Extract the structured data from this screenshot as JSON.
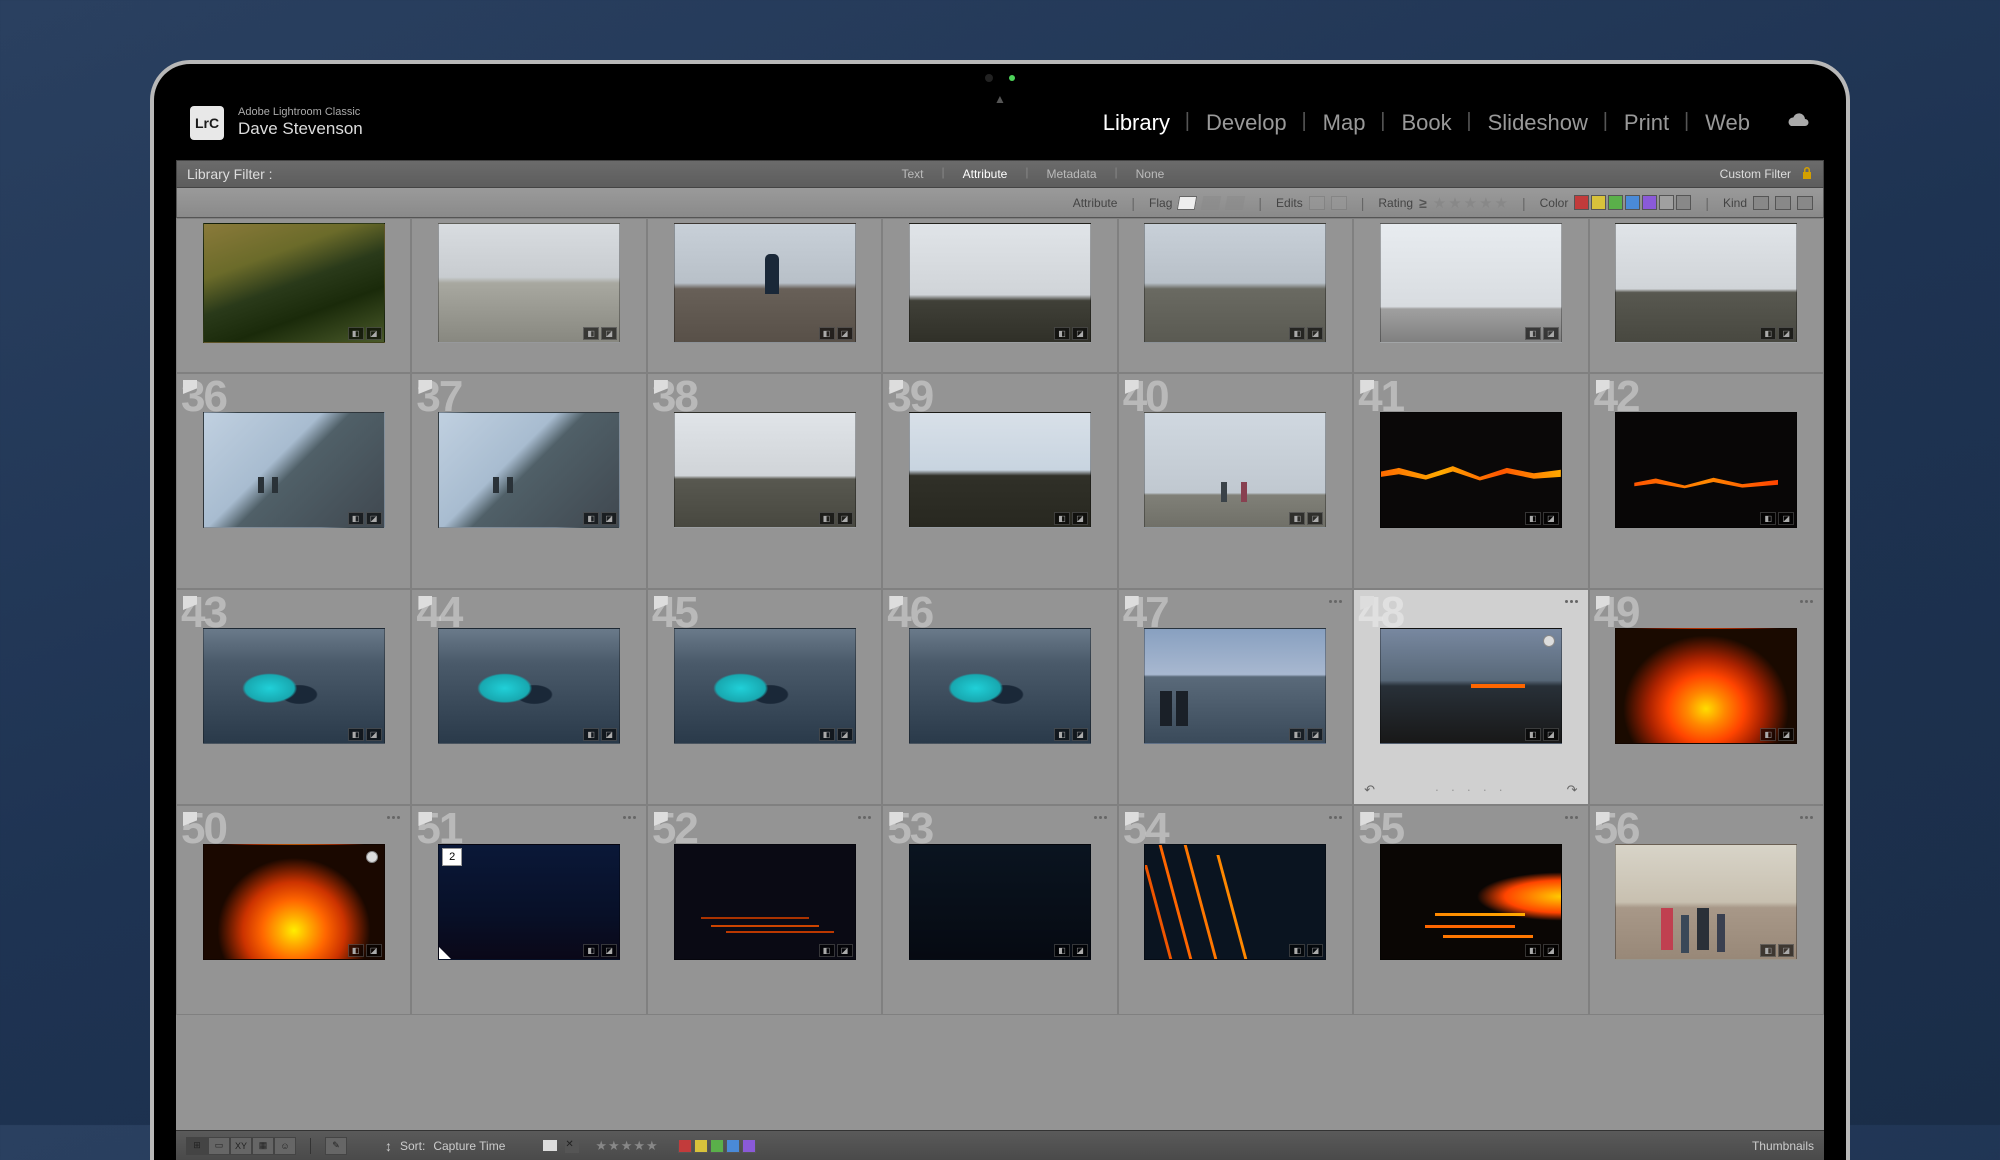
{
  "brand": {
    "logo": "LrC",
    "product": "Adobe Lightroom Classic",
    "user": "Dave Stevenson"
  },
  "modules": [
    {
      "label": "Library",
      "active": true
    },
    {
      "label": "Develop",
      "active": false
    },
    {
      "label": "Map",
      "active": false
    },
    {
      "label": "Book",
      "active": false
    },
    {
      "label": "Slideshow",
      "active": false
    },
    {
      "label": "Print",
      "active": false
    },
    {
      "label": "Web",
      "active": false
    }
  ],
  "filter_bar": {
    "title": "Library Filter :",
    "tabs": [
      {
        "label": "Text",
        "active": false
      },
      {
        "label": "Attribute",
        "active": true
      },
      {
        "label": "Metadata",
        "active": false
      },
      {
        "label": "None",
        "active": false
      }
    ],
    "custom": "Custom Filter"
  },
  "attribute_bar": {
    "attribute": "Attribute",
    "flag": "Flag",
    "edits": "Edits",
    "rating": "Rating",
    "color": "Color",
    "kind": "Kind",
    "swatches": [
      "#c23b3b",
      "#d8c23b",
      "#5ab04a",
      "#4a8ad8",
      "#8a5ad8",
      "#a0a0a0",
      "#888888"
    ]
  },
  "grid": {
    "rows": [
      [
        {
          "art": "t-rocks"
        },
        {
          "art": "t-falls"
        },
        {
          "art": "t-falls2"
        },
        {
          "art": "t-mist"
        },
        {
          "art": "t-fog-people"
        },
        {
          "art": "t-fog-hill"
        },
        {
          "art": "t-fog-flat"
        }
      ],
      [
        {
          "idx": "36",
          "art": "t-fog-sil"
        },
        {
          "idx": "37",
          "art": "t-fog-sil"
        },
        {
          "idx": "38",
          "art": "t-fog-flat"
        },
        {
          "idx": "39",
          "art": "t-fog-wide"
        },
        {
          "idx": "40",
          "art": "t-fog-two"
        },
        {
          "idx": "41",
          "art": "t-lava-crack"
        },
        {
          "idx": "42",
          "art": "t-lava-crack2"
        }
      ],
      [
        {
          "idx": "43",
          "art": "t-sit-blue"
        },
        {
          "idx": "44",
          "art": "t-sit-blue"
        },
        {
          "idx": "45",
          "art": "t-sit-blue"
        },
        {
          "idx": "46",
          "art": "t-sit-blue"
        },
        {
          "idx": "47",
          "art": "t-crater-view",
          "stack": true
        },
        {
          "idx": "48",
          "art": "t-dusk-lava",
          "sync": true,
          "stack": true,
          "selected": true,
          "footer": true
        },
        {
          "idx": "49",
          "art": "t-eruption",
          "stack": true
        }
      ],
      [
        {
          "idx": "50",
          "art": "t-eruption2",
          "sync": true,
          "stack": true
        },
        {
          "idx": "51",
          "art": "t-night-blue",
          "stack": true,
          "stackBadge": "2",
          "corner": true
        },
        {
          "idx": "52",
          "art": "t-night-dark",
          "stack": true
        },
        {
          "idx": "53",
          "art": "t-night-darker",
          "stack": true
        },
        {
          "idx": "54",
          "art": "t-lava-rivers",
          "stack": true
        },
        {
          "idx": "55",
          "art": "t-lava-flow",
          "stack": true
        },
        {
          "idx": "56",
          "art": "t-tourists",
          "stack": true
        }
      ]
    ]
  },
  "bottom": {
    "sort_label": "Sort:",
    "sort_value": "Capture Time",
    "thumbnails": "Thumbnails",
    "swatches": [
      "#c23b3b",
      "#d8c23b",
      "#5ab04a",
      "#4a8ad8",
      "#8a5ad8"
    ]
  }
}
